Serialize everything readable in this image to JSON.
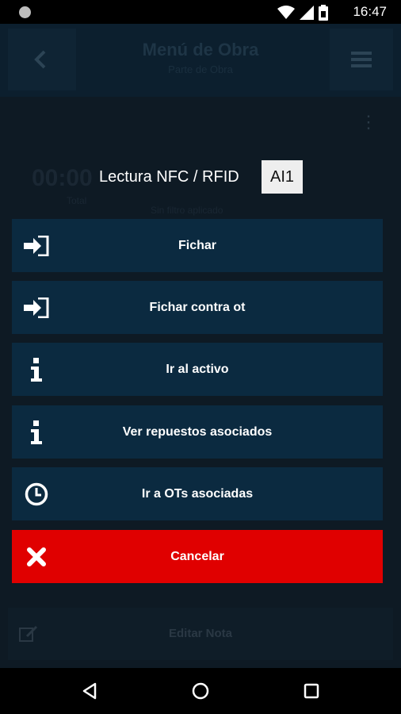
{
  "status_bar": {
    "time": "16:47",
    "icons": [
      "wifi-icon",
      "signal-icon",
      "battery-icon"
    ]
  },
  "background_screen": {
    "title": "Menú de Obra",
    "subtitle": "Parte de Obra",
    "counter": "00:00",
    "total_label": "Total",
    "filter_label": "Sin filtro aplicado",
    "bottom_button": "Editar Nota"
  },
  "dialog": {
    "title": "Lectura NFC / RFID",
    "tag": "AI1",
    "actions": [
      {
        "label": "Fichar",
        "icon": "sign-in-icon"
      },
      {
        "label": "Fichar contra ot",
        "icon": "sign-in-icon"
      },
      {
        "label": "Ir al activo",
        "icon": "info-icon"
      },
      {
        "label": "Ver repuestos asociados",
        "icon": "info-icon"
      },
      {
        "label": "Ir a OTs asociadas",
        "icon": "clock-icon"
      }
    ],
    "cancel": {
      "label": "Cancelar",
      "icon": "close-icon"
    }
  },
  "colors": {
    "action_bg": "#0b2a40",
    "cancel_bg": "#e00000",
    "app_bg": "#0e1a24"
  },
  "navigation_bar": {
    "buttons": [
      "back-icon",
      "home-icon",
      "recents-icon"
    ]
  }
}
